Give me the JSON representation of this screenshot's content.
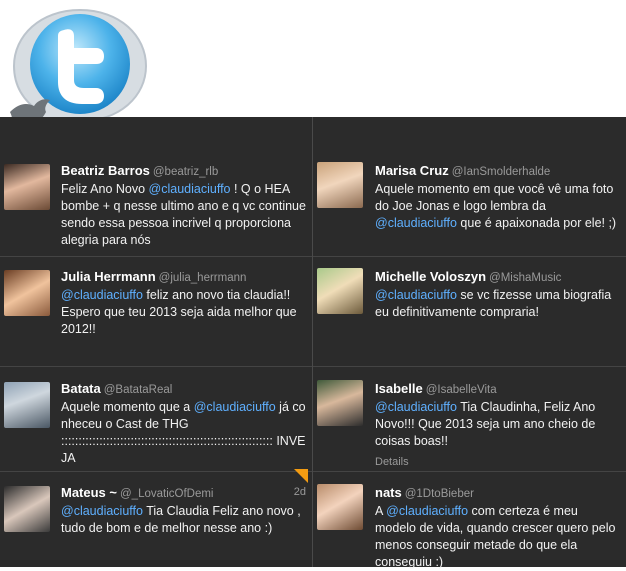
{
  "brand": {
    "logo": "twitter-bird-icon"
  },
  "colors": {
    "background": "#2b2b2b",
    "mention": "#5fb0ff",
    "logo_blue": "#3fa9e5"
  },
  "tweets": [
    {
      "name": "Beatriz Barros",
      "handle": "@beatriz_rlb",
      "pre": "Feliz Ano Novo ",
      "mention": "@claudiaciuffo",
      "post": " ! Q o HEA bombe + q nesse ultimo ano e q vc continue sendo essa pessoa incrivel q proporciona alegria para nós"
    },
    {
      "name": "Julia Herrmann",
      "handle": "@julia_herrmann",
      "pre": "",
      "mention": "@claudiaciuffo",
      "post": " feliz ano novo tia claudia!! Espero que teu 2013 seja aida melhor que 2012!!"
    },
    {
      "name": "Batata",
      "handle": "@BatataReal",
      "pre": "Aquele momento que a ",
      "mention": "@claudiaciuffo",
      "post": " já conheceu o Cast de THG ::::::::::::::::::::::::::::::::::::::::::::::::::::::::::::: INVEJA"
    },
    {
      "name": "Mateus ~",
      "handle": "@_LovaticOfDemi",
      "time": "2d",
      "pre": "",
      "mention": "@claudiaciuffo",
      "post": " Tia Claudia Feliz ano novo , tudo de bom e de melhor nesse ano :)"
    },
    {
      "name": "Marisa Cruz",
      "handle": "@IanSmolderhalde",
      "pre": "Aquele momento em que você vê uma foto do Joe Jonas e logo lembra da ",
      "mention": "@claudiaciuffo",
      "post": " que é apaixonada por ele! ;)"
    },
    {
      "name": "Michelle Voloszyn",
      "handle": "@MishaMusic",
      "pre": "",
      "mention": "@claudiaciuffo",
      "post": " se vc fizesse uma biografia eu definitivamente compraria!"
    },
    {
      "name": "Isabelle",
      "handle": "@IsabelleVita",
      "pre": "",
      "mention": "@claudiaciuffo",
      "post": " Tia Claudinha, Feliz Ano Novo!!! Que 2013 seja um ano cheio de coisas boas!!",
      "details": "Details"
    },
    {
      "name": "nats",
      "handle": "@1DtoBieber",
      "pre": "A ",
      "mention": "@claudiaciuffo",
      "post": " com certeza é meu modelo de vida, quando crescer quero pelo menos conseguir metade do que ela conseguiu :)"
    }
  ]
}
